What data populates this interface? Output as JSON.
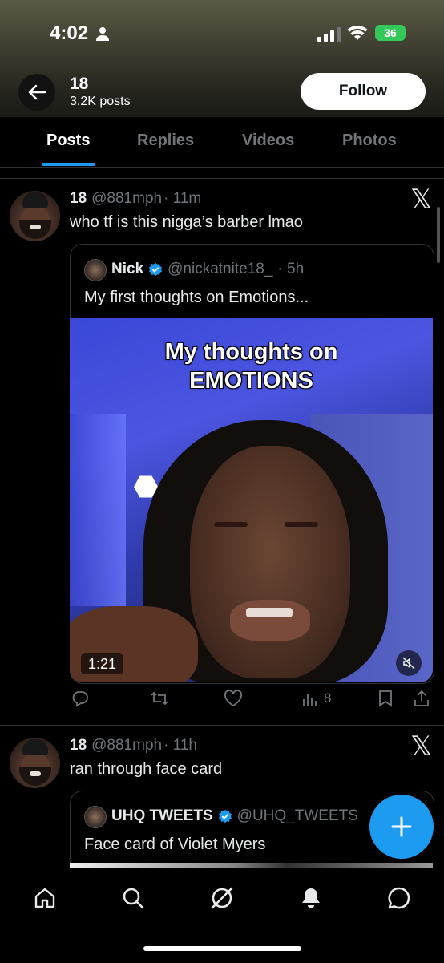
{
  "status_bar": {
    "time": "4:02",
    "battery": "36"
  },
  "header": {
    "name": "18",
    "posts_count": "3.2K posts",
    "follow_label": "Follow"
  },
  "tabs": [
    {
      "label": "Posts",
      "active": true
    },
    {
      "label": "Replies",
      "active": false
    },
    {
      "label": "Videos",
      "active": false
    },
    {
      "label": "Photos",
      "active": false
    }
  ],
  "posts": [
    {
      "name": "18",
      "handle": "@881mph",
      "time": "· 11m",
      "text": "who tf is this nigga’s barber lmao",
      "quote": {
        "name": "Nick",
        "handle": "@nickatnite18_",
        "time": "· 5h",
        "text": "My first thoughts on Emotions...",
        "video_caption_line1": "My thoughts on",
        "video_caption_line2": "EMOTIONS",
        "video_duration": "1:21"
      },
      "views": "8"
    },
    {
      "name": "18",
      "handle": "@881mph",
      "time": "· 11h",
      "text": "ran through face card",
      "quote": {
        "name": "UHQ TWEETS",
        "handle": "@UHQ_TWEETS",
        "text": "Face card of Violet Myers"
      }
    }
  ],
  "icons": {
    "back": "arrow-left-icon",
    "x_logo": "x-logo-icon",
    "reply": "reply-icon",
    "retweet": "retweet-icon",
    "like": "heart-icon",
    "views": "views-icon",
    "bookmark": "bookmark-icon",
    "share": "share-icon",
    "compose": "plus-icon",
    "nav": [
      "home-icon",
      "search-icon",
      "grok-icon",
      "notifications-icon",
      "messages-icon"
    ]
  },
  "colors": {
    "accent": "#1d9bf0",
    "verified": "#1d9bf0",
    "battery": "#34c759"
  }
}
